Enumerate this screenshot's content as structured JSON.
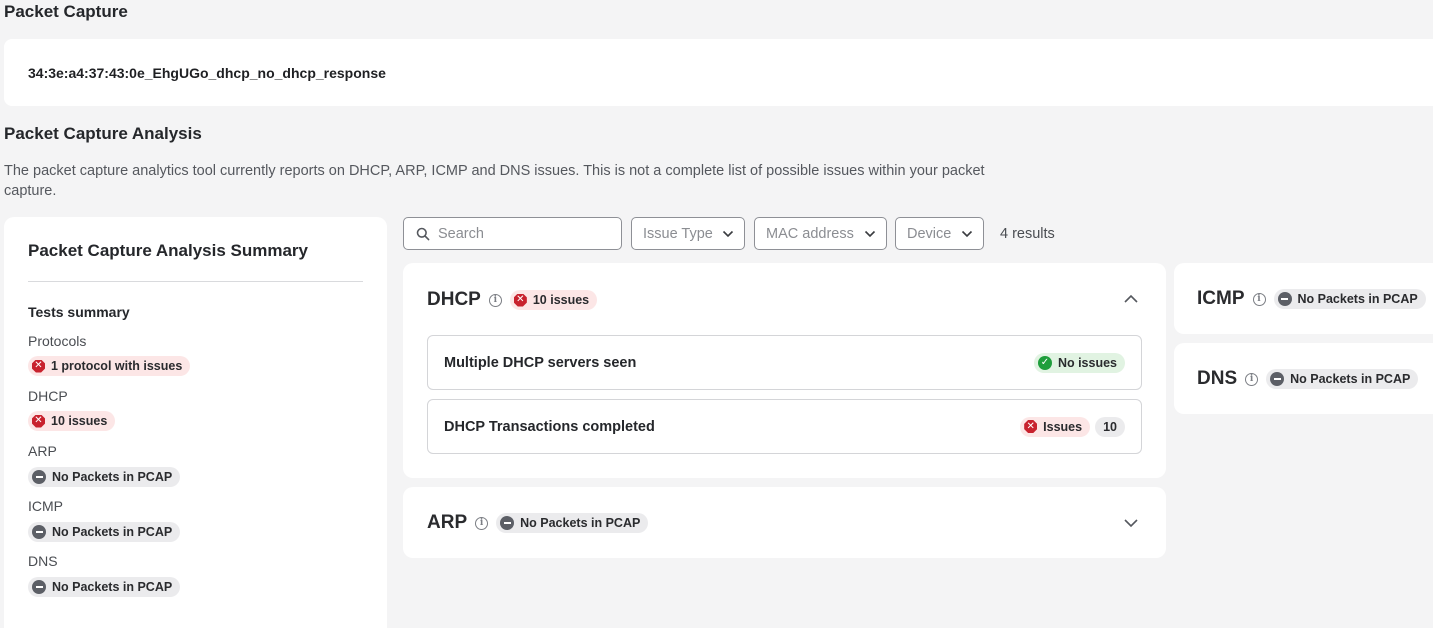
{
  "header": {
    "title": "Packet Capture",
    "file_name": "34:3e:a4:37:43:0e_EhgUGo_dhcp_no_dhcp_response"
  },
  "analysis": {
    "title": "Packet Capture Analysis",
    "description": "The packet capture analytics tool currently reports on DHCP, ARP, ICMP and DNS issues. This is not a complete list of possible issues within your packet capture."
  },
  "summary": {
    "title": "Packet Capture Analysis Summary",
    "tests_title": "Tests summary",
    "rows": [
      {
        "label": "Protocols",
        "badge": "1 protocol with issues",
        "status": "red"
      },
      {
        "label": "DHCP",
        "badge": "10 issues",
        "status": "red"
      },
      {
        "label": "ARP",
        "badge": "No Packets in PCAP",
        "status": "grey"
      },
      {
        "label": "ICMP",
        "badge": "No Packets in PCAP",
        "status": "grey"
      },
      {
        "label": "DNS",
        "badge": "No Packets in PCAP",
        "status": "grey"
      }
    ]
  },
  "toolbar": {
    "search_placeholder": "Search",
    "issue_type": "Issue Type",
    "mac_address": "MAC address",
    "device": "Device",
    "results": "4 results"
  },
  "cards": {
    "dhcp": {
      "name": "DHCP",
      "badge": "10 issues",
      "tests": [
        {
          "name": "Multiple DHCP servers seen",
          "status_label": "No issues"
        },
        {
          "name": "DHCP Transactions completed",
          "status_label": "Issues",
          "count": "10"
        }
      ]
    },
    "arp": {
      "name": "ARP",
      "badge": "No Packets in PCAP"
    },
    "icmp": {
      "name": "ICMP",
      "badge": "No Packets in PCAP"
    },
    "dns": {
      "name": "DNS",
      "badge": "No Packets in PCAP"
    }
  },
  "colors": {
    "error": "#c8222e",
    "success": "#1f9e3c",
    "neutral": "#5c5f66",
    "page_bg": "#f4f4f5"
  }
}
